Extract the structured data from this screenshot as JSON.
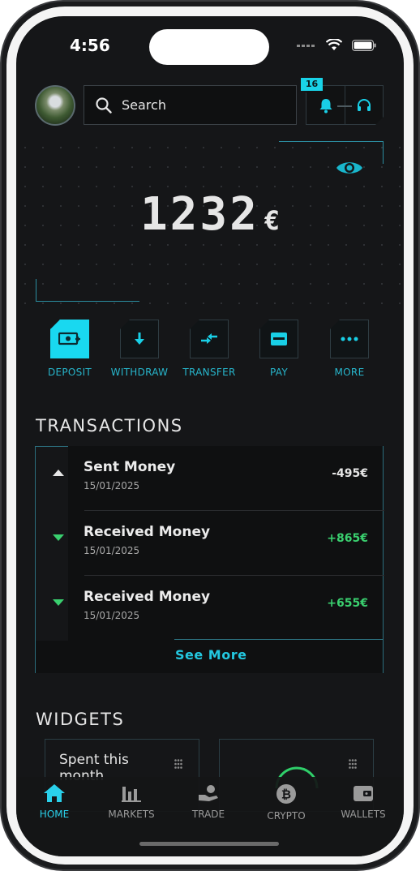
{
  "status_bar": {
    "time": "4:56"
  },
  "header": {
    "search_placeholder": "Search",
    "notification_count": "16"
  },
  "balance": {
    "amount": "1232",
    "currency": "€"
  },
  "actions": [
    {
      "label": "DEPOSIT",
      "icon": "deposit-icon",
      "active": true
    },
    {
      "label": "WITHDRAW",
      "icon": "withdraw-icon",
      "active": false
    },
    {
      "label": "TRANSFER",
      "icon": "transfer-icon",
      "active": false
    },
    {
      "label": "PAY",
      "icon": "card-icon",
      "active": false
    },
    {
      "label": "MORE",
      "icon": "more-icon",
      "active": false
    }
  ],
  "transactions": {
    "title": "TRANSACTIONS",
    "items": [
      {
        "name": "Sent Money",
        "date": "15/01/2025",
        "amount": "-495€",
        "direction": "out"
      },
      {
        "name": "Received Money",
        "date": "15/01/2025",
        "amount": "+865€",
        "direction": "in"
      },
      {
        "name": "Received Money",
        "date": "15/01/2025",
        "amount": "+655€",
        "direction": "in"
      }
    ],
    "see_more": "See More"
  },
  "widgets": {
    "title": "WIDGETS",
    "items": [
      {
        "text": "Spent this month"
      },
      {
        "text": ""
      }
    ]
  },
  "tabbar": [
    {
      "label": "HOME",
      "icon": "home-icon",
      "active": true
    },
    {
      "label": "MARKETS",
      "icon": "bar-chart-icon",
      "active": false
    },
    {
      "label": "TRADE",
      "icon": "trade-icon",
      "active": false
    },
    {
      "label": "CRYPTO",
      "icon": "bitcoin-icon",
      "active": false
    },
    {
      "label": "WALLETS",
      "icon": "wallet-icon",
      "active": false
    }
  ],
  "colors": {
    "accent": "#19d8f0",
    "positive": "#3ad06f",
    "background": "#151618"
  }
}
